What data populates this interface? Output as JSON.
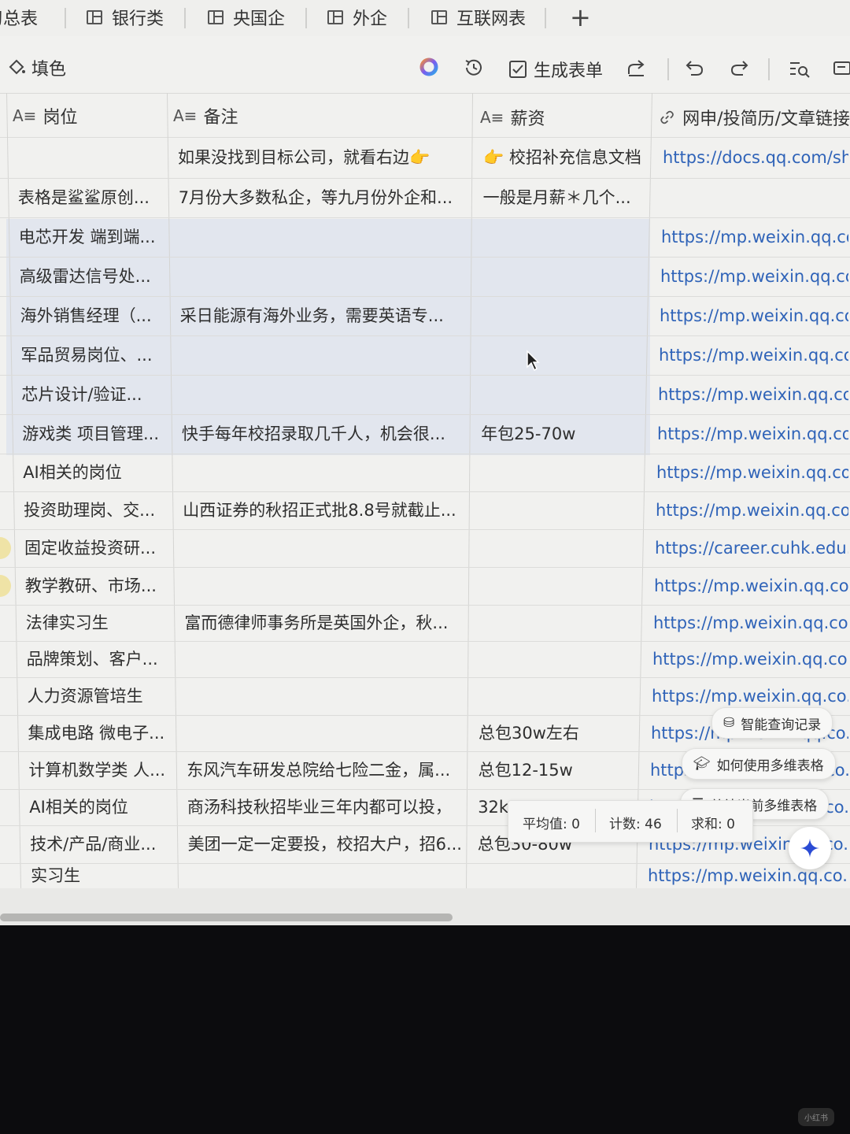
{
  "tabs": [
    {
      "label": "习总表"
    },
    {
      "label": "银行类"
    },
    {
      "label": "央国企"
    },
    {
      "label": "外企"
    },
    {
      "label": "互联网表"
    }
  ],
  "toolbar": {
    "fill_label": "填色",
    "form_label": "生成表单"
  },
  "columns": [
    {
      "label": "岗位",
      "type_icon": "text-field-icon"
    },
    {
      "label": "备注",
      "type_icon": "text-field-icon"
    },
    {
      "label": "薪资",
      "type_icon": "text-field-icon"
    },
    {
      "label": "网申/投简历/文章链接",
      "type_icon": "link-icon"
    }
  ],
  "rows": [
    {
      "position": "",
      "note": "如果没找到目标公司，就看右边👉",
      "salary": "👉 校招补充信息文档",
      "link": "https://docs.qq.com/sh..."
    },
    {
      "position": "表格是鲨鲨原创...",
      "note": "7月份大多数私企，等九月份外企和...",
      "salary": "一般是月薪＊几个...",
      "link": ""
    },
    {
      "position": "电芯开发 端到端...",
      "note": "",
      "salary": "",
      "link": "https://mp.weixin.qq.co..."
    },
    {
      "position": "高级雷达信号处...",
      "note": "",
      "salary": "",
      "link": "https://mp.weixin.qq.co..."
    },
    {
      "position": "海外销售经理（...",
      "note": "采日能源有海外业务，需要英语专...",
      "salary": "",
      "link": "https://mp.weixin.qq.co..."
    },
    {
      "position": "军品贸易岗位、...",
      "note": "",
      "salary": "",
      "link": "https://mp.weixin.qq.co..."
    },
    {
      "position": "芯片设计/验证...",
      "note": "",
      "salary": "",
      "link": "https://mp.weixin.qq.co..."
    },
    {
      "position": "游戏类 项目管理...",
      "note": "快手每年校招录取几千人，机会很...",
      "salary": "年包25-70w",
      "link": "https://mp.weixin.qq.co..."
    },
    {
      "position": "AI相关的岗位",
      "note": "",
      "salary": "",
      "link": "https://mp.weixin.qq.co..."
    },
    {
      "position": "投资助理岗、交...",
      "note": "山西证券的秋招正式批8.8号就截止...",
      "salary": "",
      "link": "https://mp.weixin.qq.co..."
    },
    {
      "position": "固定收益投资研...",
      "note": "",
      "salary": "",
      "link": "https://career.cuhk.edu..."
    },
    {
      "position": "教学教研、市场...",
      "note": "",
      "salary": "",
      "link": "https://mp.weixin.qq.co..."
    },
    {
      "position": "法律实习生",
      "note": "富而德律师事务所是英国外企，秋...",
      "salary": "",
      "link": "https://mp.weixin.qq.co..."
    },
    {
      "position": "品牌策划、客户...",
      "note": "",
      "salary": "",
      "link": "https://mp.weixin.qq.co..."
    },
    {
      "position": "人力资源管培生",
      "note": "",
      "salary": "",
      "link": "https://mp.weixin.qq.co..."
    },
    {
      "position": "集成电路 微电子...",
      "note": "",
      "salary": "总包30w左右",
      "link": "https://mp.weixin.qq.co..."
    },
    {
      "position": "计算机数学类 人...",
      "note": "东风汽车研发总院给七险二金，属...",
      "salary": "总包12-15w",
      "link": "https://mp.weixin.qq.co..."
    },
    {
      "position": "AI相关的岗位",
      "note": "商汤科技秋招毕业三年内都可以投，",
      "salary": "32k",
      "link": "https://mp.weixin.qq.co..."
    },
    {
      "position": "技术/产品/商业...",
      "note": "美团一定一定要投，校招大户，招6...",
      "salary": "总包30-80w",
      "link": "https://mp.weixin.qq.co..."
    },
    {
      "position": "实习生",
      "note": "",
      "salary": "",
      "link": "https://mp.weixin.qq.co..."
    }
  ],
  "floating": {
    "smart_query": "智能查询记录",
    "how_to_use": "如何使用多维表格",
    "summarize": "总结当前多维表格",
    "stats_avg": "平均值: 0",
    "stats_count": "计数: 46",
    "stats_sum": "求和: 0"
  },
  "watermark": "小红书",
  "colors": {
    "link": "#2f63b8",
    "highlight_row": "#e2e6ee",
    "background": "#f1f1ef",
    "ai_star": "#2a4bd4"
  }
}
